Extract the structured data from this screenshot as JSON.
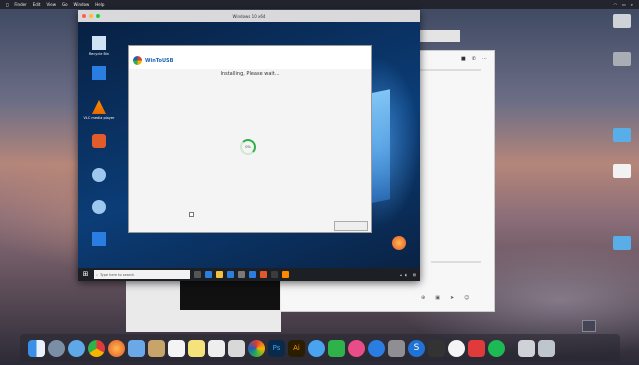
{
  "menubar": {
    "items": [
      "",
      "Finder",
      "Edit",
      "View",
      "Go",
      "Window",
      "Help"
    ],
    "right": [
      "",
      "",
      ""
    ]
  },
  "mac_desktop_icons": [
    {
      "label": "",
      "icon": "drive-icon"
    },
    {
      "label": "",
      "icon": "drive-icon"
    },
    {
      "label": "",
      "icon": "folder-icon"
    },
    {
      "label": "",
      "icon": "document-icon"
    },
    {
      "label": "",
      "icon": "folder-icon"
    }
  ],
  "vm": {
    "title": "Windows 10 x64"
  },
  "win_icons": [
    {
      "label": "Recycle Bin",
      "icon": "recycle-bin-icon"
    },
    {
      "label": "",
      "icon": "app-icon"
    },
    {
      "label": "VLC media player",
      "icon": "vlc-icon"
    },
    {
      "label": "",
      "icon": "app-icon"
    },
    {
      "label": "",
      "icon": "app-icon"
    },
    {
      "label": "",
      "icon": "app-icon"
    },
    {
      "label": "",
      "icon": "app-icon"
    },
    {
      "label": "",
      "icon": "app-icon"
    }
  ],
  "taskbar": {
    "search_placeholder": "Type here to search",
    "clock": ""
  },
  "dialog": {
    "window_title": "",
    "logo_text": "WinToUSB",
    "logo_sub": "",
    "header_links": [
      "",
      ""
    ],
    "status": "Installing, Please wait...",
    "percent": "0%",
    "progress": 0,
    "checkbox_label": "",
    "footer_link": "",
    "footer_button": ""
  },
  "dock_apps": [
    "finder",
    "launchpad",
    "safari",
    "chrome",
    "firefox",
    "mail",
    "photos",
    "notes",
    "calendar",
    "reminders",
    "maps",
    "photoshop",
    "illustrator",
    "app-store",
    "itunes",
    "system-preferences",
    "terminal",
    "skype",
    "whatsapp",
    "parallels",
    "spotify",
    "trash"
  ]
}
